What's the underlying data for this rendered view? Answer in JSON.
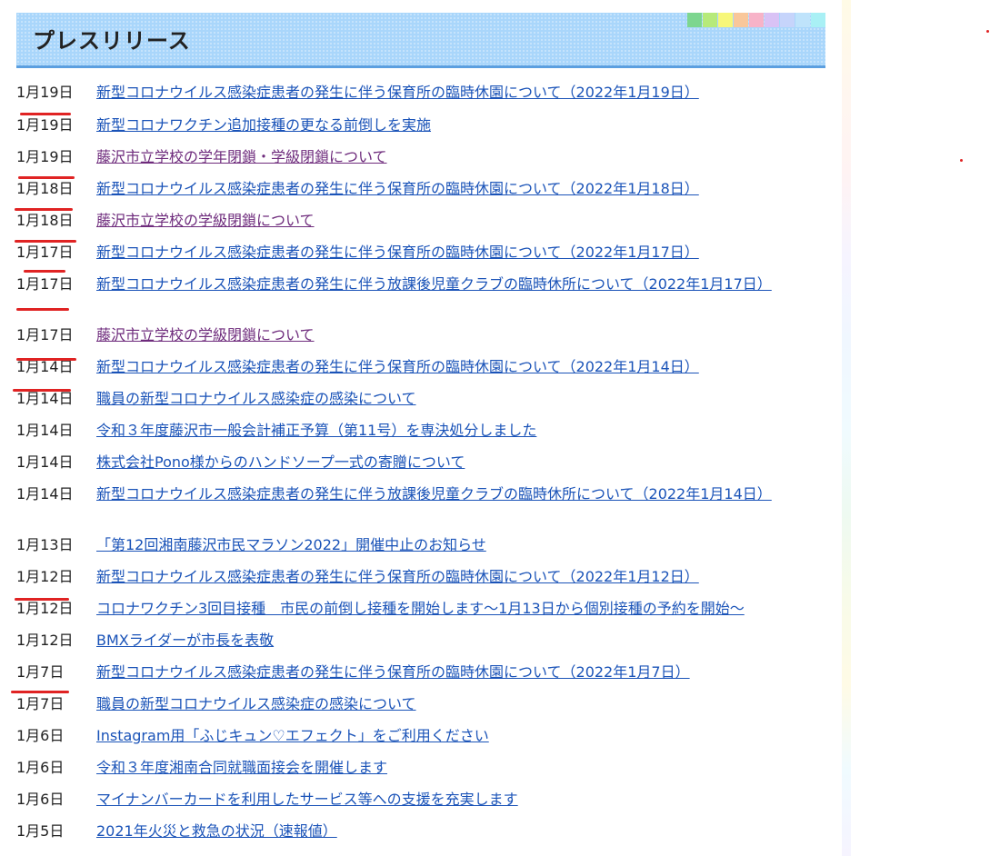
{
  "header": {
    "title": "プレスリリース",
    "swatch_colors": [
      "#7dd68f",
      "#b6ea7a",
      "#f7f77a",
      "#f9c79a",
      "#f7b3c8",
      "#d9c2f5",
      "#c6d4fb",
      "#bfe3fb",
      "#a9f0f5"
    ]
  },
  "releases": [
    {
      "date": "1月19日",
      "title": "新型コロナウイルス感染症患者の発生に伴う保育所の臨時休園について（2022年1月19日）",
      "visited": false
    },
    {
      "date": "1月19日",
      "title": "新型コロナワクチン追加接種の更なる前倒しを実施",
      "visited": false
    },
    {
      "date": "1月19日",
      "title": "藤沢市立学校の学年閉鎖・学級閉鎖について",
      "visited": true
    },
    {
      "date": "1月18日",
      "title": "新型コロナウイルス感染症患者の発生に伴う保育所の臨時休園について（2022年1月18日）",
      "visited": false
    },
    {
      "date": "1月18日",
      "title": "藤沢市立学校の学級閉鎖について",
      "visited": true
    },
    {
      "date": "1月17日",
      "title": "新型コロナウイルス感染症患者の発生に伴う保育所の臨時休園について（2022年1月17日）",
      "visited": false
    },
    {
      "date": "1月17日",
      "title": "新型コロナウイルス感染症患者の発生に伴う放課後児童クラブの臨時休所について（2022年1月17日）",
      "visited": false
    },
    {
      "date": "1月17日",
      "title": "藤沢市立学校の学級閉鎖について",
      "visited": true
    },
    {
      "date": "1月14日",
      "title": "新型コロナウイルス感染症患者の発生に伴う保育所の臨時休園について（2022年1月14日）",
      "visited": false
    },
    {
      "date": "1月14日",
      "title": "職員の新型コロナウイルス感染症の感染について",
      "visited": false
    },
    {
      "date": "1月14日",
      "title": "令和３年度藤沢市一般会計補正予算（第11号）を専決処分しました",
      "visited": false
    },
    {
      "date": "1月14日",
      "title": "株式会社Pono様からのハンドソープ一式の寄贈について",
      "visited": false
    },
    {
      "date": "1月14日",
      "title": "新型コロナウイルス感染症患者の発生に伴う放課後児童クラブの臨時休所について（2022年1月14日）",
      "visited": false
    },
    {
      "date": "1月13日",
      "title": "「第12回湘南藤沢市民マラソン2022」開催中止のお知らせ",
      "visited": false
    },
    {
      "date": "1月12日",
      "title": "新型コロナウイルス感染症患者の発生に伴う保育所の臨時休園について（2022年1月12日）",
      "visited": false
    },
    {
      "date": "1月12日",
      "title": "コロナワクチン3回目接種　市民の前倒し接種を開始します～1月13日から個別接種の予約を開始～",
      "visited": false
    },
    {
      "date": "1月12日",
      "title": "BMXライダーが市長を表敬",
      "visited": false
    },
    {
      "date": "1月7日",
      "title": "新型コロナウイルス感染症患者の発生に伴う保育所の臨時休園について（2022年1月7日）",
      "visited": false
    },
    {
      "date": "1月7日",
      "title": "職員の新型コロナウイルス感染症の感染について",
      "visited": false
    },
    {
      "date": "1月6日",
      "title": "Instagram用「ふじキュン♡エフェクト」をご利用ください",
      "visited": false
    },
    {
      "date": "1月6日",
      "title": "令和３年度湘南合同就職面接会を開催します",
      "visited": false
    },
    {
      "date": "1月6日",
      "title": "マイナンバーカードを利用したサービス等への支援を充実します",
      "visited": false
    },
    {
      "date": "1月5日",
      "title": "2021年火災と救急の状況（速報値）",
      "visited": false
    }
  ]
}
